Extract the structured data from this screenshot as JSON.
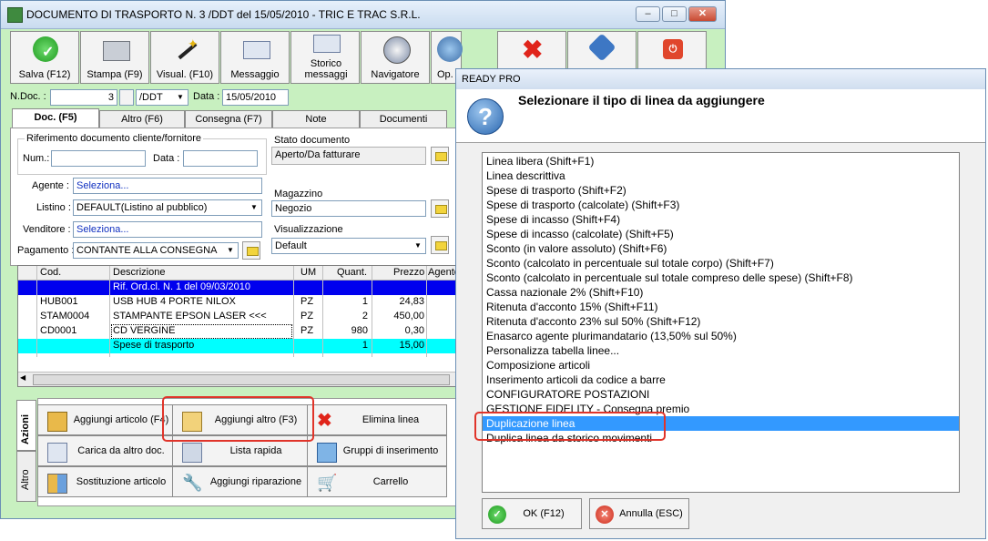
{
  "main_window": {
    "title": "DOCUMENTO DI TRASPORTO N. 3 /DDT del 15/05/2010 - TRIC E TRAC S.R.L.",
    "toolbar": [
      {
        "label": "Salva (F12)",
        "icon": "save-check-icon"
      },
      {
        "label": "Stampa (F9)",
        "icon": "printer-icon"
      },
      {
        "label": "Visual. (F10)",
        "icon": "magic-wand-icon"
      },
      {
        "label": "Messaggio",
        "icon": "envelope-pen-icon"
      },
      {
        "label": "Storico messaggi",
        "icon": "envelope-search-icon"
      },
      {
        "label": "Navigatore",
        "icon": "compass-icon"
      },
      {
        "label": "Op.",
        "icon": "gears-icon"
      }
    ],
    "header_fields": {
      "ndoc_label": "N.Doc. :",
      "ndoc_value": "3",
      "series_value": "/DDT",
      "data_label": "Data :",
      "data_value": "15/05/2010"
    },
    "tabs": [
      "Doc. (F5)",
      "Altro (F6)",
      "Consegna (F7)",
      "Note",
      "Documenti"
    ],
    "doc_panel": {
      "riferimento_title": "Riferimento documento cliente/fornitore",
      "num_label": "Num.:",
      "data_label": "Data :",
      "agente_label": "Agente :",
      "agente_value": "Seleziona...",
      "listino_label": "Listino :",
      "listino_value": "DEFAULT(Listino al pubblico)",
      "venditore_label": "Venditore :",
      "venditore_value": "Seleziona...",
      "pagamento_label": "Pagamento :",
      "pagamento_value": "CONTANTE ALLA CONSEGNA",
      "stato_label": "Stato documento",
      "stato_value": "Aperto/Da fatturare",
      "magazzino_label": "Magazzino",
      "magazzino_value": "Negozio",
      "visualizzazione_label": "Visualizzazione",
      "visualizzazione_value": "Default"
    },
    "grid": {
      "columns": [
        "Cod.",
        "Descrizione",
        "UM",
        "Quant.",
        "Prezzo",
        "Agente"
      ],
      "rows": [
        {
          "cod": "",
          "descr": "Rif. Ord.cl. N. 1 del 09/03/2010",
          "um": "",
          "quant": "",
          "prezzo": "",
          "style": "blue"
        },
        {
          "cod": "HUB001",
          "descr": "USB HUB 4 PORTE NILOX",
          "um": "PZ",
          "quant": "1",
          "prezzo": "24,83",
          "style": "normal"
        },
        {
          "cod": "STAM0004",
          "descr": "STAMPANTE EPSON LASER <<<",
          "um": "PZ",
          "quant": "2",
          "prezzo": "450,00",
          "style": "normal"
        },
        {
          "cod": "CD0001",
          "descr": "CD VERGINE",
          "um": "PZ",
          "quant": "980",
          "prezzo": "0,30",
          "style": "normal"
        },
        {
          "cod": "",
          "descr": "Spese di trasporto",
          "um": "",
          "quant": "1",
          "prezzo": "15,00",
          "style": "cyan"
        }
      ]
    },
    "side_tabs": [
      "Azioni",
      "Altro"
    ],
    "actions": [
      {
        "label": "Aggiungi articolo (F4)",
        "icon": "box-add-icon"
      },
      {
        "label": "Aggiungi altro (F3)",
        "icon": "grid-add-icon"
      },
      {
        "label": "Elimina linea",
        "icon": "delete-x-icon"
      },
      {
        "label": "Carica da altro doc.",
        "icon": "document-load-icon"
      },
      {
        "label": "Lista rapida",
        "icon": "list-pen-icon"
      },
      {
        "label": "Gruppi di inserimento",
        "icon": "group-add-icon"
      },
      {
        "label": "Sostituzione articolo",
        "icon": "swap-blocks-icon"
      },
      {
        "label": "Aggiungi riparazione",
        "icon": "wrench-icon"
      },
      {
        "label": "Carrello",
        "icon": "cart-icon"
      }
    ]
  },
  "dialog": {
    "title": "READY PRO",
    "heading": "Selezionare il tipo di linea da aggiungere",
    "options": [
      "Linea libera (Shift+F1)",
      "Linea descrittiva",
      "Spese di trasporto (Shift+F2)",
      "Spese di trasporto (calcolate) (Shift+F3)",
      "Spese di incasso (Shift+F4)",
      "Spese di incasso (calcolate) (Shift+F5)",
      "Sconto (in valore assoluto) (Shift+F6)",
      "Sconto (calcolato in percentuale sul totale corpo) (Shift+F7)",
      "Sconto (calcolato in percentuale sul totale compreso delle spese) (Shift+F8)",
      "Cassa nazionale 2% (Shift+F10)",
      "Ritenuta d'acconto 15% (Shift+F11)",
      "Ritenuta d'acconto 23% sul 50% (Shift+F12)",
      "Enasarco agente plurimandatario (13,50% sul 50%)",
      "Personalizza tabella linee...",
      "Composizione articoli",
      "Inserimento articoli da codice a barre",
      "CONFIGURATORE POSTAZIONI",
      "GESTIONE FIDELITY - Consegna premio",
      "Duplicazione linea",
      "Duplica linea da storico movimenti"
    ],
    "selected_option": "Duplicazione linea",
    "ok_label": "OK (F12)",
    "cancel_label": "Annulla (ESC)"
  },
  "colors": {
    "window_bg": "#c8f0c0",
    "selection": "#3399ff",
    "highlight_blue_row": "#0000ee",
    "highlight_cyan_row": "#00ffff",
    "annotation_red": "#e0342a"
  }
}
